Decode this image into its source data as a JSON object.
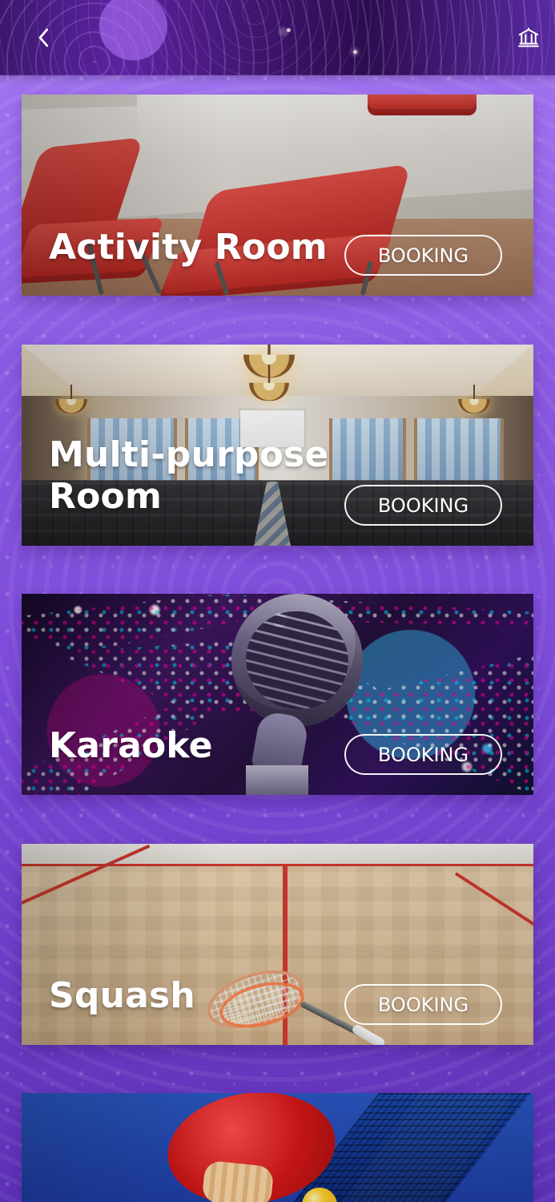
{
  "header": {
    "icons": {
      "back": "chevron-left-icon",
      "home": "institution-icon"
    }
  },
  "cards": [
    {
      "title": "Activity Room",
      "booking_label": "BOOKING"
    },
    {
      "title": "Multi-purpose Room",
      "booking_label": "BOOKING"
    },
    {
      "title": "Karaoke",
      "booking_label": "BOOKING"
    },
    {
      "title": "Squash",
      "booking_label": "BOOKING"
    },
    {
      "title": "",
      "booking_label": ""
    }
  ],
  "colors": {
    "page_top": "#a678f2",
    "page_bottom": "#5d31b6",
    "header": "#4a1c84",
    "text": "#ffffff",
    "button_border": "#ffffff"
  }
}
